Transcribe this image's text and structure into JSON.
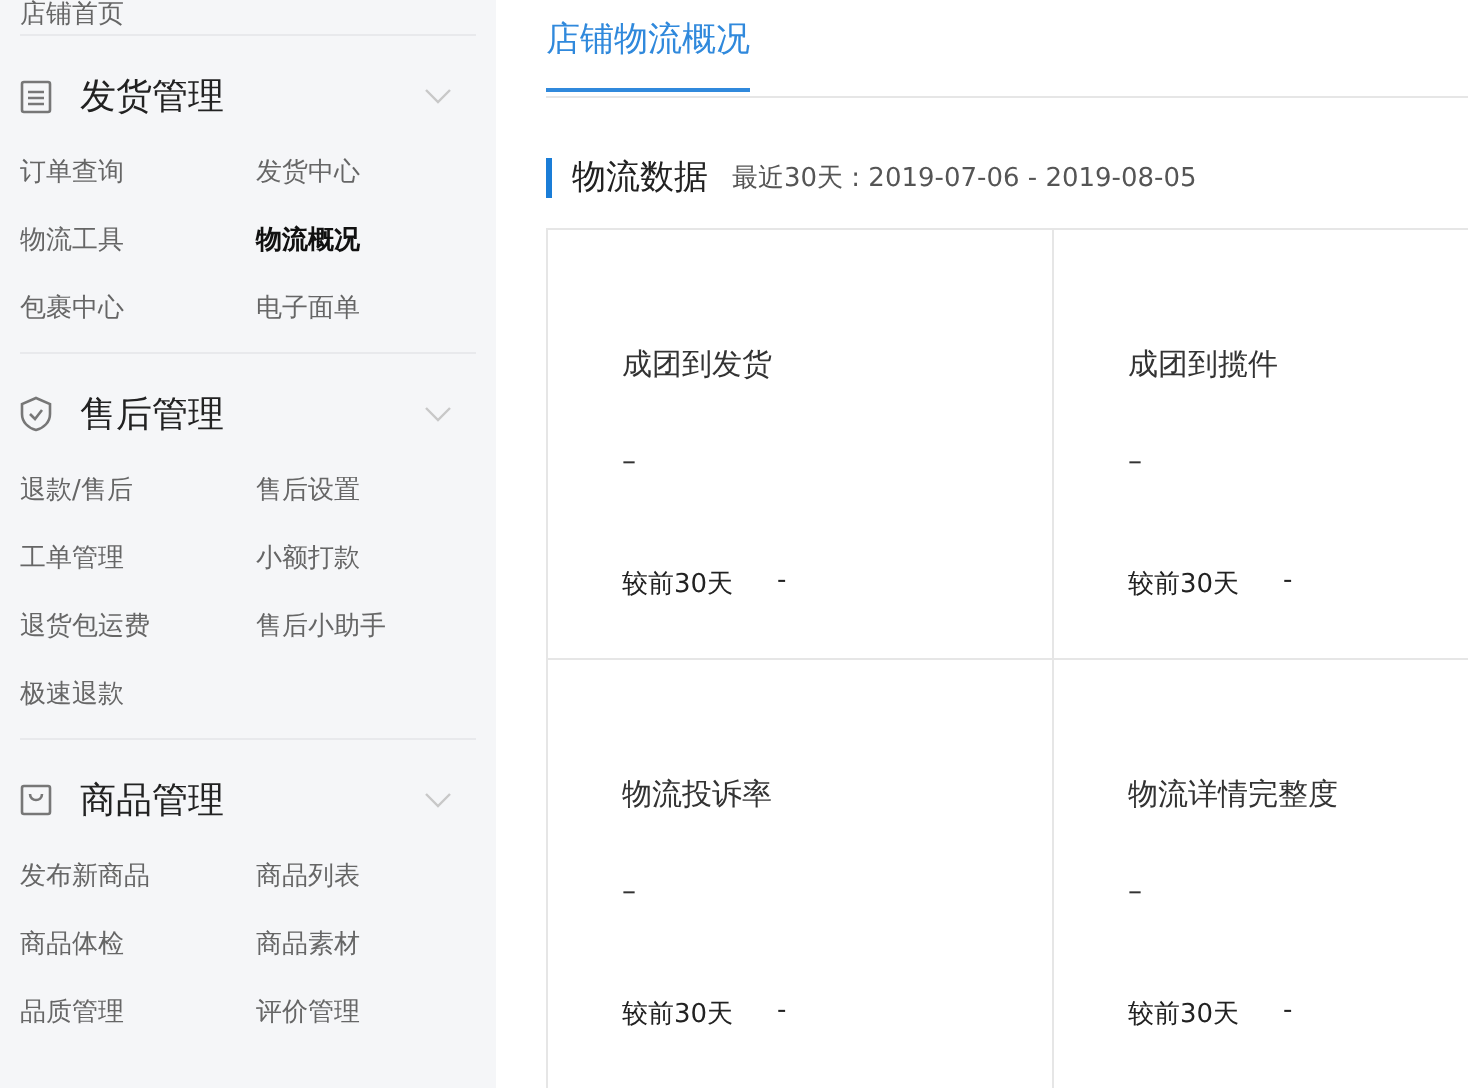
{
  "sidebar": {
    "top_item": "店铺首页",
    "sections": [
      {
        "kind": "list",
        "title": "发货管理",
        "expanded": true,
        "items": [
          {
            "label": "订单查询",
            "selected": false
          },
          {
            "label": "发货中心",
            "selected": false
          },
          {
            "label": "物流工具",
            "selected": false
          },
          {
            "label": "物流概况",
            "selected": true
          },
          {
            "label": "包裹中心",
            "selected": false
          },
          {
            "label": "电子面单",
            "selected": false
          }
        ]
      },
      {
        "kind": "shield",
        "title": "售后管理",
        "expanded": true,
        "items": [
          {
            "label": "退款/售后",
            "selected": false
          },
          {
            "label": "售后设置",
            "selected": false
          },
          {
            "label": "工单管理",
            "selected": false
          },
          {
            "label": "小额打款",
            "selected": false
          },
          {
            "label": "退货包运费",
            "selected": false
          },
          {
            "label": "售后小助手",
            "selected": false
          },
          {
            "label": "极速退款",
            "selected": false
          }
        ]
      },
      {
        "kind": "bag",
        "title": "商品管理",
        "expanded": true,
        "items": [
          {
            "label": "发布新商品",
            "selected": false
          },
          {
            "label": "商品列表",
            "selected": false
          },
          {
            "label": "商品体检",
            "selected": false
          },
          {
            "label": "商品素材",
            "selected": false
          },
          {
            "label": "品质管理",
            "selected": false
          },
          {
            "label": "评价管理",
            "selected": false
          }
        ]
      }
    ]
  },
  "tabs": [
    {
      "label": "店铺物流概况",
      "selected": true
    }
  ],
  "section": {
    "title": "物流数据",
    "subtitle": "最近30天 : 2019-07-06 - 2019-08-05"
  },
  "cards": [
    {
      "title": "成团到发货",
      "value": "–",
      "compare_label": "较前30天",
      "compare_value": "-"
    },
    {
      "title": "成团到揽件",
      "value": "–",
      "compare_label": "较前30天",
      "compare_value": "-"
    },
    {
      "title": "物流投诉率",
      "value": "–",
      "compare_label": "较前30天",
      "compare_value": "-"
    },
    {
      "title": "物流详情完整度",
      "value": "–",
      "compare_label": "较前30天",
      "compare_value": "-"
    }
  ]
}
